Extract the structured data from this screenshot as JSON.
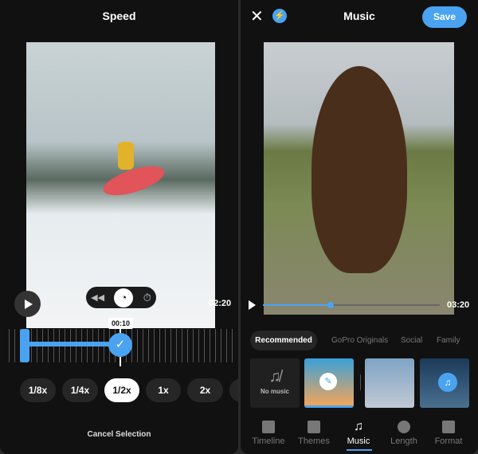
{
  "speed_screen": {
    "title": "Speed",
    "duration": "02:20",
    "marker_time": "00:10",
    "speed_options": [
      "1/8x",
      "1/4x",
      "1/2x",
      "1x",
      "2x"
    ],
    "selected_speed": "1/2x",
    "cancel_label": "Cancel Selection",
    "icons": [
      "play-icon",
      "rewind-icon",
      "speedometer-icon",
      "timer-icon",
      "check-icon"
    ]
  },
  "music_screen": {
    "title": "Music",
    "save_label": "Save",
    "duration": "03:20",
    "playback_progress": 0.38,
    "tabs": [
      "Recommended",
      "GoPro Originals",
      "Social",
      "Family"
    ],
    "active_tab": "Recommended",
    "no_music_label": "No music",
    "nav": [
      "Timeline",
      "Themes",
      "Music",
      "Length",
      "Format"
    ],
    "active_nav": "Music"
  },
  "colors": {
    "accent": "#4aa3f0",
    "background": "#111111"
  }
}
